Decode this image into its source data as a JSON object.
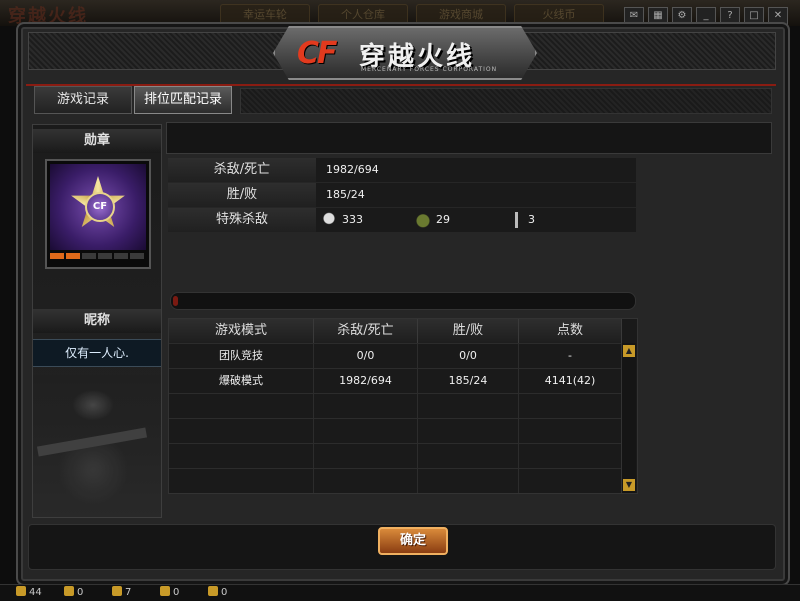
{
  "topbar": {
    "bg_logo": "穿越火线",
    "bg_tabs": [
      "幸运车轮",
      "个人仓库",
      "游戏商城",
      "火线币"
    ]
  },
  "dialog": {
    "logo_cf": "CF",
    "logo_title": "穿越火线",
    "logo_subtitle": "MERCENARY  FORCES  CORPORATION"
  },
  "tabs": [
    {
      "label": "游戏记录",
      "active": false
    },
    {
      "label": "排位匹配记录",
      "active": true
    }
  ],
  "left_panel": {
    "medal_title": "勋章",
    "medal_letters": "CF",
    "medal_pips": [
      true,
      true,
      false,
      false,
      false,
      false
    ],
    "nickname_title": "昵称",
    "nickname": "仅有一人心."
  },
  "stats": {
    "kill_death_label": "杀敌/死亡",
    "kill_death_value": "1982/694",
    "win_lose_label": "胜/败",
    "win_lose_value": "185/24",
    "special_label": "特殊杀敌",
    "special": {
      "headshot": "333",
      "grenade": "29",
      "knife": "3"
    }
  },
  "progress_fraction": 0.01,
  "modes_table": {
    "headers": [
      "游戏模式",
      "杀敌/死亡",
      "胜/败",
      "点数"
    ],
    "rows": [
      [
        "团队竞技",
        "0/0",
        "0/0",
        "-"
      ],
      [
        "爆破模式",
        "1982/694",
        "185/24",
        "4141(42)"
      ]
    ]
  },
  "ok_button": "确定",
  "status_bar": {
    "items": [
      "44",
      "0",
      "7",
      "0",
      "0"
    ]
  },
  "colors": {
    "accent_orange": "#c89a28",
    "brand_red": "#e23a1e"
  }
}
